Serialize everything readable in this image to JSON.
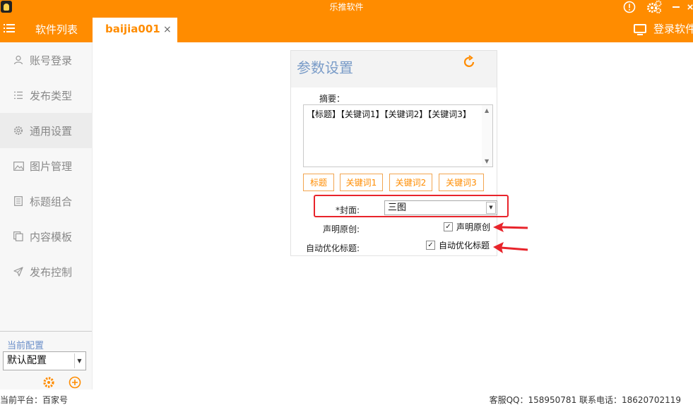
{
  "window": {
    "title": "乐推软件"
  },
  "tabs": {
    "list_label": "软件列表",
    "active_label": "baijia001",
    "close_glyph": "×"
  },
  "header": {
    "login_label": "登录软件"
  },
  "sidebar": {
    "items": [
      {
        "label": "账号登录",
        "icon": "user-icon"
      },
      {
        "label": "发布类型",
        "icon": "list-icon"
      },
      {
        "label": "通用设置",
        "icon": "gear-icon"
      },
      {
        "label": "图片管理",
        "icon": "image-icon"
      },
      {
        "label": "标题组合",
        "icon": "document-icon"
      },
      {
        "label": "内容模板",
        "icon": "copy-icon"
      },
      {
        "label": "发布控制",
        "icon": "send-icon"
      }
    ],
    "active_index": 2,
    "current_config_label": "当前配置",
    "config_value": "默认配置"
  },
  "panel": {
    "title": "参数设置",
    "summary_label": "摘要：",
    "summary_text": "【标题】【关键词1】【关键词2】【关键词3】",
    "keyword_buttons": [
      "标题",
      "关键词1",
      "关键词2",
      "关键词3"
    ],
    "cover_label": "*封面:",
    "cover_value": "三图",
    "original_label": "声明原创:",
    "original_checkbox": "声明原创",
    "optimize_label": "自动优化标题:",
    "optimize_checkbox": "自动优化标题",
    "original_checked": true,
    "optimize_checked": true
  },
  "status": {
    "platform": "当前平台：百家号",
    "contact": "客服QQ：158950781   联系电话：18620702119"
  },
  "colors": {
    "accent": "#ff8c00",
    "annotation": "#e8242b",
    "label_blue": "#7a9cc8"
  }
}
